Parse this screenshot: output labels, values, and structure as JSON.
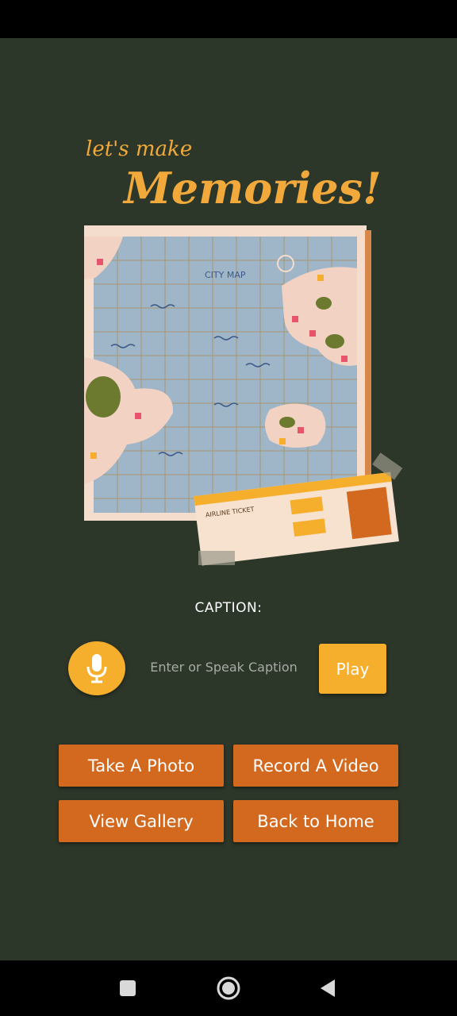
{
  "illustration": {
    "heading_small": "let's make",
    "heading_large": "Memories!",
    "map_label": "CITY MAP",
    "ticket_label": "AIRLINE TICKET"
  },
  "caption": {
    "label": "CAPTION:",
    "placeholder": "Enter or Speak Caption",
    "value": ""
  },
  "play_label": "Play",
  "actions": {
    "take_photo": "Take A Photo",
    "record_video": "Record A Video",
    "view_gallery": "View Gallery",
    "back_home": "Back to Home"
  },
  "icons": {
    "mic": "microphone-icon",
    "nav_recent": "square-icon",
    "nav_home": "circle-icon",
    "nav_back": "triangle-back-icon"
  },
  "colors": {
    "background": "#2c3629",
    "accent_yellow": "#f6ae2d",
    "button_orange": "#d2691e"
  }
}
